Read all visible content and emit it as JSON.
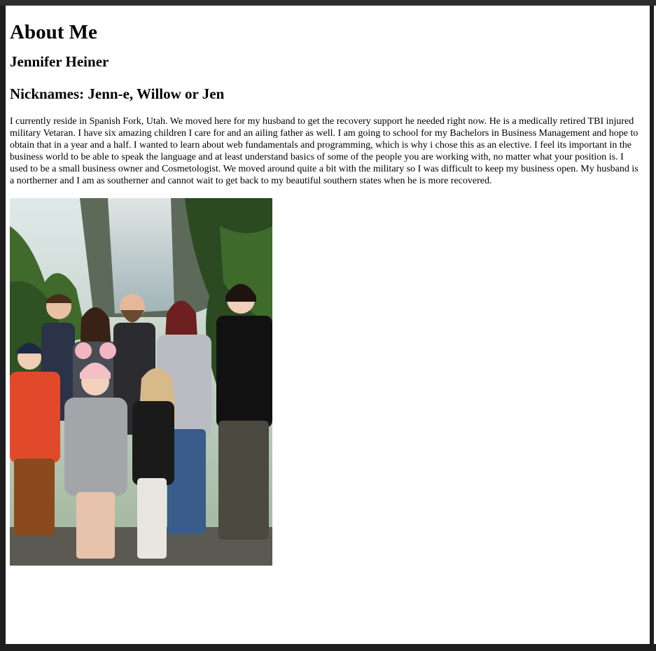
{
  "page": {
    "heading": "About Me",
    "name": "Jennifer Heiner",
    "nicknames": "Nicknames: Jenn-e, Willow or Jen",
    "bio": "I currently reside in Spanish Fork, Utah. We moved here for my husband to get the recovery support he needed right now. He is a medically retired TBI injured military Vetaran. I have six amazing children I care for and an ailing father as well. I am going to school for my Bachelors in Business Management and hope to obtain that in a year and a half. I wanted to learn about web fundamentals and programming, which is why i chose this as an elective. I feel its important in the business world to be able to speak the language and at least understand basics of some of the people you are working with, no matter what your position is. I used to be a small business owner and Cosmetologist. We moved around quite a bit with the military so I was difficult to keep my business open. My husband is a northerner and I am as southerner and cannot wait to get back to my beautiful southern states when he is more recovered.",
    "photo_alt": "family photo"
  },
  "colors": {
    "page_background": "#ffffff",
    "frame": "#1e1e1e",
    "text": "#000000"
  }
}
